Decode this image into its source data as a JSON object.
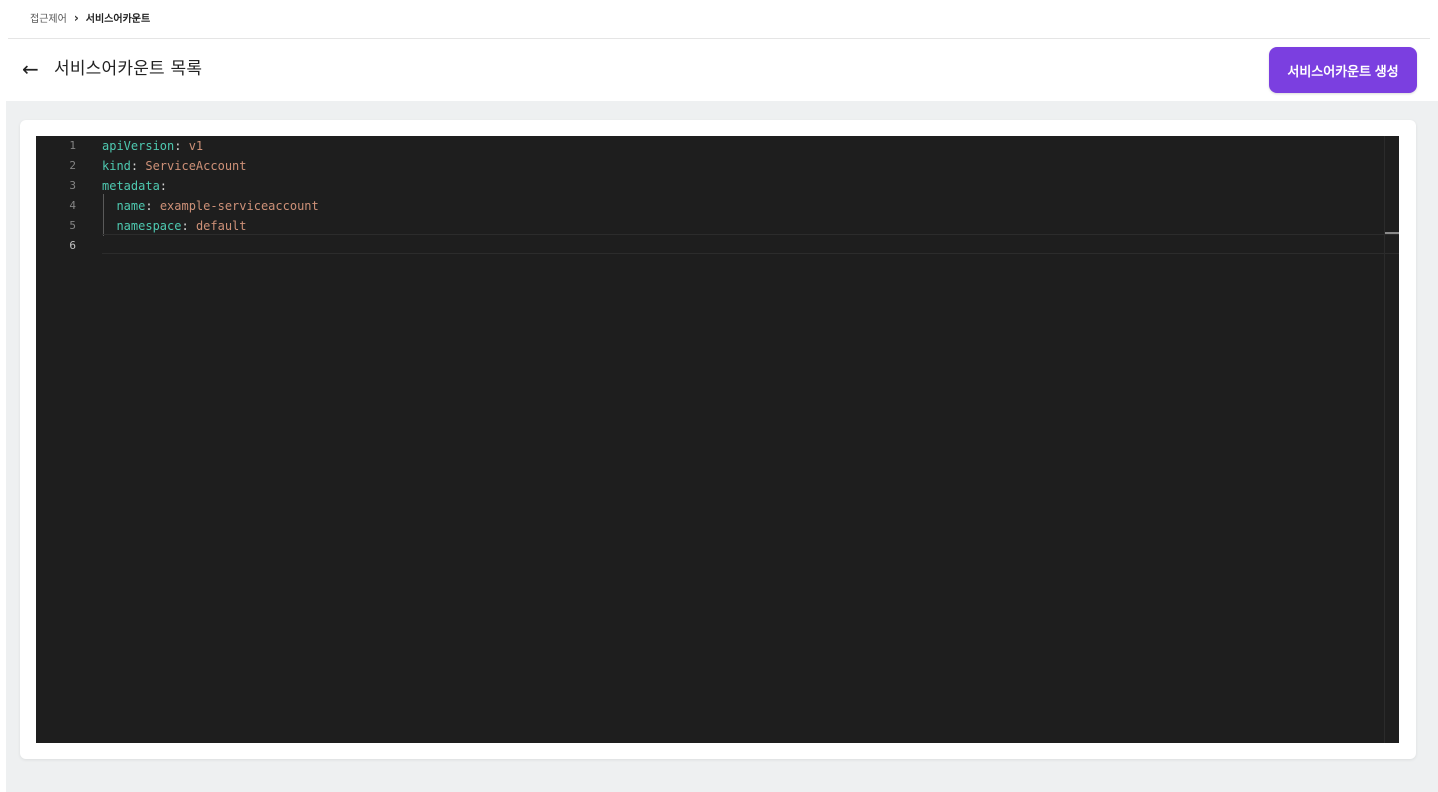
{
  "breadcrumb": {
    "parent": "접근제어",
    "separator": "›",
    "current": "서비스어카운트"
  },
  "header": {
    "back_icon": "←",
    "title": "서비스어카운트 목록",
    "create_button_label": "서비스어카운트 생성"
  },
  "editor": {
    "line_numbers": [
      "1",
      "2",
      "3",
      "4",
      "5",
      "6"
    ],
    "lines": [
      {
        "indent": "",
        "key": "apiVersion",
        "sep": ": ",
        "value": "v1"
      },
      {
        "indent": "",
        "key": "kind",
        "sep": ": ",
        "value": "ServiceAccount"
      },
      {
        "indent": "",
        "key": "metadata",
        "sep": ":",
        "value": ""
      },
      {
        "indent": "  ",
        "key": "name",
        "sep": ": ",
        "value": "example-serviceaccount"
      },
      {
        "indent": "  ",
        "key": "namespace",
        "sep": ": ",
        "value": "default"
      },
      {
        "indent": "",
        "key": "",
        "sep": "",
        "value": ""
      }
    ],
    "active_line": 6
  },
  "colors": {
    "accent": "#7b3fe0",
    "editor_bg": "#1e1e1e",
    "yaml_key": "#4ec9b0",
    "yaml_value": "#ce9178",
    "page_bg": "#eef0f1"
  },
  "icons": {
    "back": "arrow-left-icon",
    "separator": "chevron-right-icon"
  }
}
